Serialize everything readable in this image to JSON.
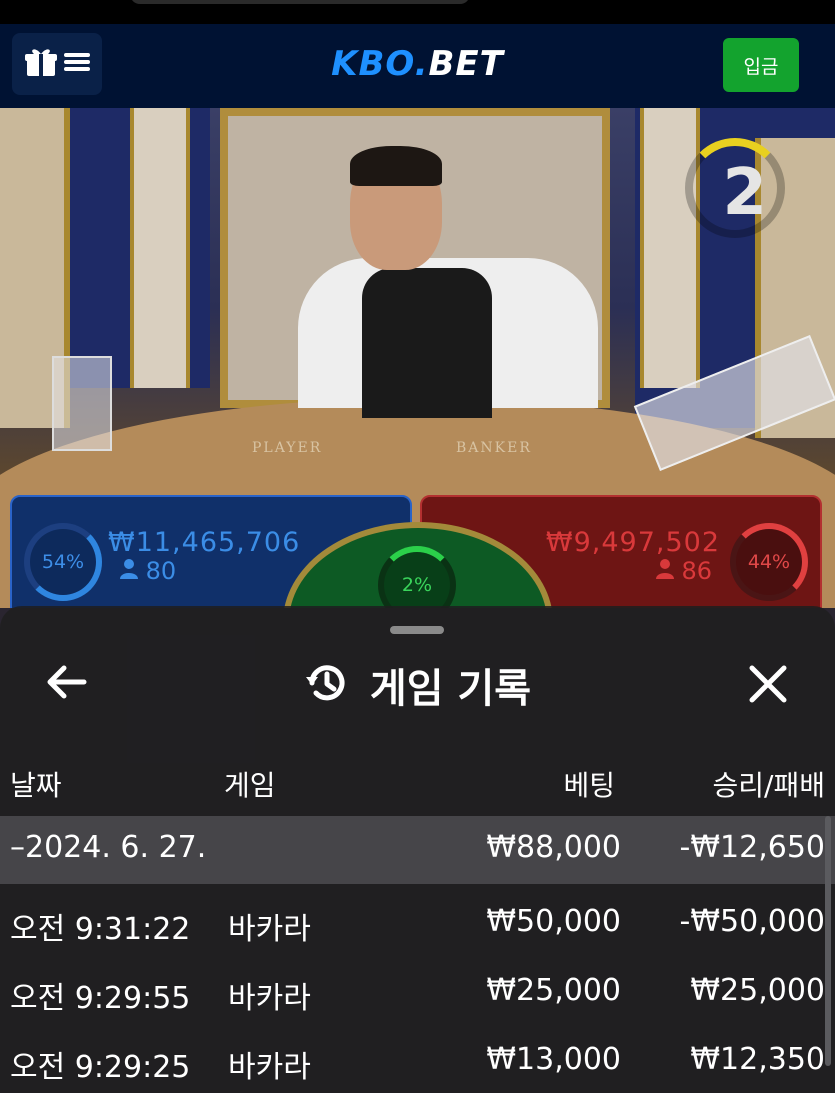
{
  "header": {
    "logo_main": "KBO.",
    "logo_suffix": "BET",
    "deposit_label": "입금"
  },
  "video": {
    "countdown": "2",
    "table_player_label": "PLAYER",
    "table_banker_label": "BANKER"
  },
  "bets": {
    "player": {
      "percent": "54%",
      "amount": "₩11,465,706",
      "users": "80",
      "fill": 0.54
    },
    "banker": {
      "percent": "44%",
      "amount": "₩9,497,502",
      "users": "86",
      "fill": 0.44
    },
    "tie": {
      "percent": "2%",
      "fill": 0.02
    }
  },
  "history": {
    "title": "게임 기록",
    "columns": {
      "date": "날짜",
      "game": "게임",
      "bet": "베팅",
      "result": "승리/패배"
    },
    "date_group": {
      "label": "–2024. 6. 27.",
      "bet": "₩88,000",
      "result": "-₩12,650"
    },
    "rows": [
      {
        "time": "오전 9:31:22",
        "game": "바카라",
        "bet": "₩50,000",
        "result": "-₩50,000"
      },
      {
        "time": "오전 9:29:55",
        "game": "바카라",
        "bet": "₩25,000",
        "result": "₩25,000"
      },
      {
        "time": "오전 9:29:25",
        "game": "바카라",
        "bet": "₩13,000",
        "result": "₩12,350"
      }
    ]
  },
  "colors": {
    "header_bg": "#001233",
    "logo_blue": "#1e90ff",
    "deposit_green": "#13a32e",
    "player_blue": "#2f86e0",
    "banker_red": "#e04040",
    "tie_green": "#2bd04a"
  }
}
